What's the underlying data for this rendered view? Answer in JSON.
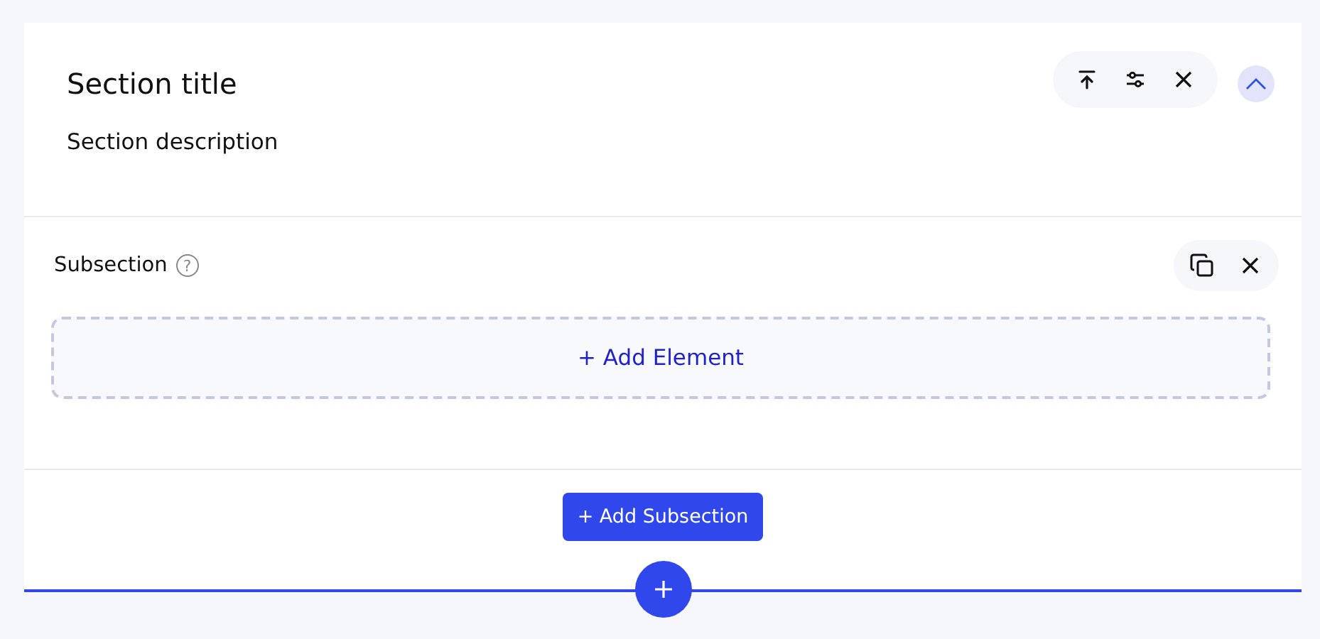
{
  "section": {
    "title": "Section title",
    "description": "Section description",
    "expanded": true
  },
  "subsection": {
    "label": "Subsection",
    "help_icon": "?",
    "add_element": "+ Add Element"
  },
  "add_subsection": "+ Add Subsection"
}
